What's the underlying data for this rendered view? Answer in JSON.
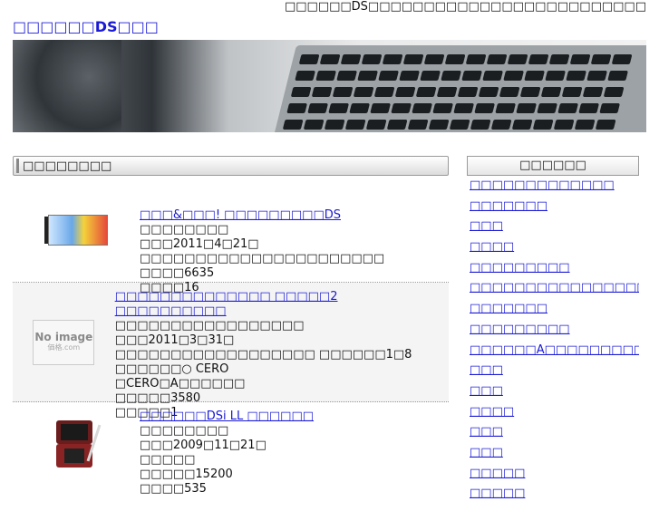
{
  "topbar": {
    "text": "□□□□□□DS□□□□□□□□□□□□□□□□□□□□□□□□□"
  },
  "site": {
    "title": "□□□□□□DS□□□"
  },
  "main": {
    "section_title": "□□□□□□□□",
    "items": [
      {
        "title": "□□□&□□□! □□□□□□□□□DS",
        "line1": "□□□□□□□□",
        "line2": "□□□2011□4□21□",
        "line3": "□□□□□□□□□□□□□□□□□□□□□□",
        "line4": "□□□□6635",
        "line5": "□□□□16",
        "thumb": "game-box-icon"
      },
      {
        "title": "□□□□□□□□□□□□□□ □□□□□2 □□□□□□□□□□",
        "line1": "□□□□□□□□□□□□□□□□□",
        "line2": "□□□2011□3□31□",
        "line3": "□□□□□□□□□□□□□□□□□□ □□□□□□1□8 □□□□□□○ CERO",
        "line4": "□CERO□A□□□□□□",
        "line5": "□□□□□3580",
        "line6": "□□□□□1",
        "thumb_label": "No image",
        "thumb_sub": "価格.com"
      },
      {
        "title": "□□□□□□DSi LL □□□□□□",
        "line1": "□□□□□□□□",
        "line2": "□□□2009□11□21□",
        "line3": "□□□□□",
        "line4": "□□□□□15200",
        "line5": "□□□□535",
        "thumb": "ds-console-icon"
      }
    ]
  },
  "sidebar": {
    "title": "□□□□□□",
    "links": [
      "□□□□□□□□□□□□□",
      "□□□□□□□",
      "□□□",
      "□□□□",
      "□□□□□□□□□",
      "□□□□□□□□□□□□□□□□□□□□□",
      "□□□□□□□",
      "□□□□□□□□□",
      "□□□□□□A□□□□□□□□□□",
      "□□□",
      "□□□",
      "□□□□",
      "□□□",
      "□□□",
      "□□□□□",
      "□□□□□"
    ]
  }
}
